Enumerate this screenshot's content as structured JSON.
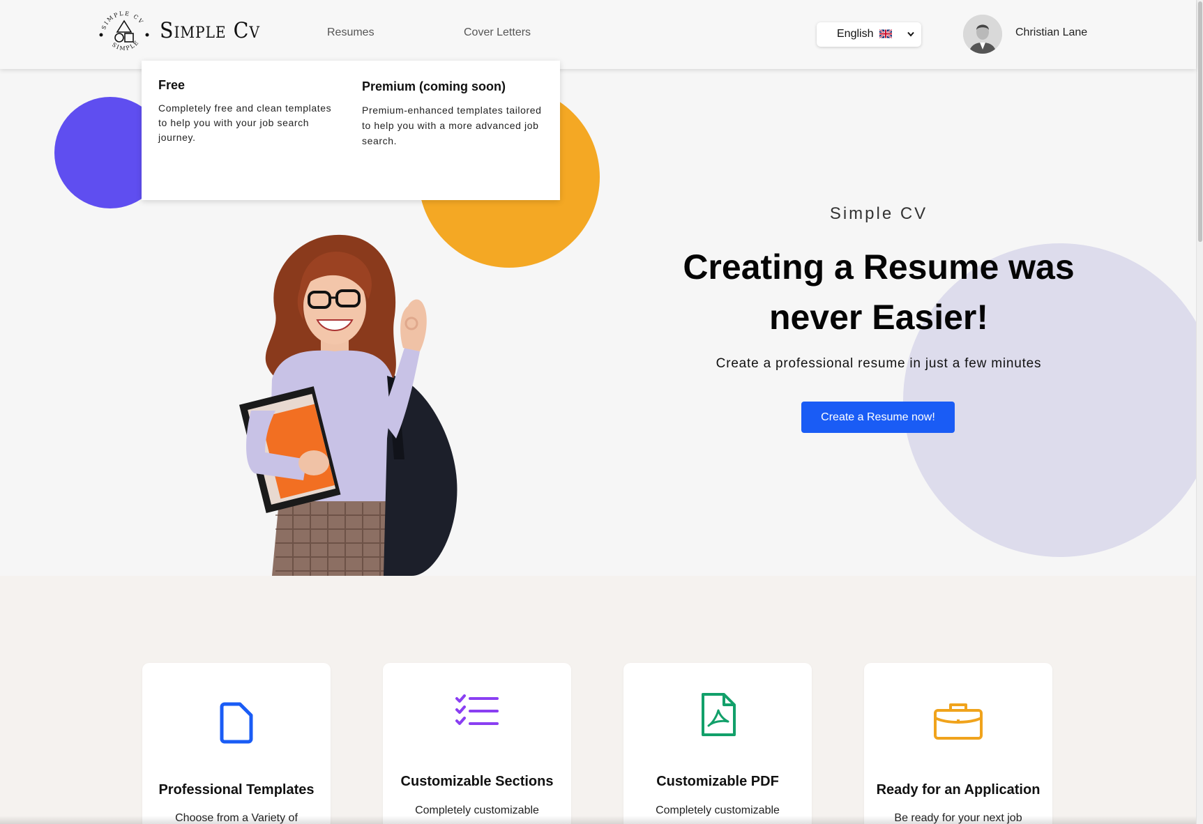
{
  "colors": {
    "accent": "#1a5cf5",
    "purple_circle": "#5f4ef0",
    "orange_circle": "#f4a824",
    "lilac_circle": "#dddcec"
  },
  "header": {
    "logo_text": "Simple Cv",
    "logo_ring_text": "SIMPLE CV SIMPLE CV",
    "nav": [
      {
        "label": "Resumes"
      },
      {
        "label": "Cover Letters"
      }
    ],
    "language": {
      "selected": "English",
      "flag_icon": "uk-flag-icon"
    },
    "user": {
      "name": "Christian Lane",
      "avatar_icon": "user-avatar-icon"
    }
  },
  "dropdown": {
    "free": {
      "title": "Free",
      "description": "Completely free and clean templates to help you with your job search journey."
    },
    "premium": {
      "title": "Premium (coming soon)",
      "description": "Premium-enhanced templates tailored to help you with a more advanced job search."
    }
  },
  "hero": {
    "subtitle": "Simple CV",
    "title_line1": "Creating a Resume was",
    "title_line2": "never Easier!",
    "tagline": "Create a professional resume in just a few minutes",
    "cta_label": "Create a Resume now!"
  },
  "features": [
    {
      "icon": "document-icon",
      "title": "Professional Templates",
      "description": "Choose from a Variety of"
    },
    {
      "icon": "checklist-icon",
      "title": "Customizable Sections",
      "description": "Completely customizable"
    },
    {
      "icon": "pdf-file-icon",
      "title": "Customizable PDF",
      "description": "Completely customizable"
    },
    {
      "icon": "briefcase-icon",
      "title": "Ready for an Application",
      "description": "Be ready for your next job"
    }
  ]
}
